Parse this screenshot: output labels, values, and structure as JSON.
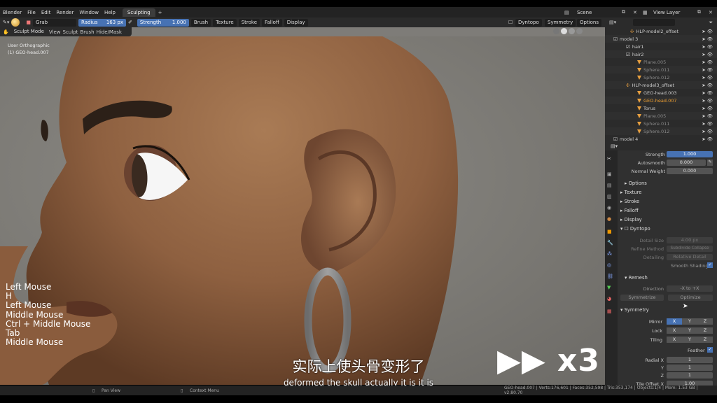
{
  "menu": {
    "items": [
      "Blender",
      "File",
      "Edit",
      "Render",
      "Window",
      "Help"
    ],
    "workspace_tab": "Sculpting",
    "add_tab": "+",
    "scene": "Scene",
    "view_layer": "View Layer"
  },
  "tool": {
    "brush_name": "Grab",
    "radius_label": "Radius",
    "radius_value": "163 px",
    "strength_label": "Strength",
    "strength_value": "1.000",
    "menus": [
      "Brush",
      "Texture",
      "Stroke",
      "Falloff",
      "Display"
    ],
    "dyntopo": "Dyntopo",
    "symmetry": "Symmetry",
    "options": "Options"
  },
  "mode": {
    "mode": "Sculpt Mode",
    "menus": [
      "View",
      "Sculpt",
      "Brush",
      "Hide/Mask"
    ]
  },
  "viewport": {
    "view_name": "User Orthographic",
    "object": "(1) GEO-head.007"
  },
  "keys": [
    "Left Mouse",
    "H",
    "Left Mouse",
    "Middle Mouse",
    "Ctrl + Middle Mouse",
    "Tab",
    "Middle Mouse"
  ],
  "overlay": {
    "speed": "x3",
    "subtitle_cn": "实际上使头骨变形了",
    "subtitle_en": "deformed the skull actually it is it is"
  },
  "outliner": [
    {
      "label": "HLP-model2_offset",
      "indent": 36,
      "type": "empty"
    },
    {
      "label": "model 3",
      "indent": 12,
      "type": "collection"
    },
    {
      "label": "hair1",
      "indent": 30,
      "type": "collection"
    },
    {
      "label": "hair2",
      "indent": 30,
      "type": "collection"
    },
    {
      "label": "Plane.005",
      "indent": 46,
      "type": "mesh",
      "dim": true
    },
    {
      "label": "Sphere.011",
      "indent": 46,
      "type": "mesh",
      "dim": true
    },
    {
      "label": "Sphere.012",
      "indent": 46,
      "type": "mesh",
      "dim": true
    },
    {
      "label": "HLP-model3_offset",
      "indent": 30,
      "type": "empty"
    },
    {
      "label": "GEO-head.003",
      "indent": 46,
      "type": "mesh"
    },
    {
      "label": "GEO-head.007",
      "indent": 46,
      "type": "mesh",
      "active": true
    },
    {
      "label": "Torus",
      "indent": 46,
      "type": "mesh"
    },
    {
      "label": "Plane.005",
      "indent": 46,
      "type": "mesh",
      "dim": true
    },
    {
      "label": "Sphere.011",
      "indent": 46,
      "type": "mesh",
      "dim": true
    },
    {
      "label": "Sphere.012",
      "indent": 46,
      "type": "mesh",
      "dim": true
    },
    {
      "label": "model 4",
      "indent": 12,
      "type": "collection"
    }
  ],
  "props": {
    "strength_label": "Strength",
    "strength_value": "1.000",
    "autosmooth_label": "Autosmooth",
    "autosmooth_value": "0.000",
    "normal_weight_label": "Normal Weight",
    "normal_weight_value": "0.000",
    "options": "Options",
    "texture": "Texture",
    "stroke": "Stroke",
    "falloff": "Falloff",
    "display": "Display",
    "dyntopo": "Dyntopo",
    "detail_size_label": "Detail Size",
    "detail_size_value": "4.00 px",
    "refine_label": "Refine Method",
    "refine_value": "Subdivide Collapse",
    "detailing_label": "Detailing",
    "detailing_value": "Relative Detail",
    "smooth_shading": "Smooth Shading",
    "remesh": "Remesh",
    "direction_label": "Direction",
    "direction_value": "-X to +X",
    "symmetrize": "Symmetrize",
    "optimize": "Optimize",
    "symmetry": "Symmetry",
    "mirror_label": "Mirror",
    "lock_label": "Lock",
    "tiling_label": "Tiling",
    "axis_x": "X",
    "axis_y": "Y",
    "axis_z": "Z",
    "feather_label": "Feather",
    "radial_x_label": "Radial X",
    "radial_y_label": "Y",
    "radial_z_label": "Z",
    "radial_x": "1",
    "radial_y": "1",
    "radial_z": "1",
    "tile_offset_label": "Tile Offset X",
    "tile_offset_value": "1.00"
  },
  "status": {
    "pan_view": "Pan View",
    "context_menu": "Context Menu",
    "stats": "GEO-head.007 | Verts:176,601 | Faces:352,598 | Tris:353,174 | Objects:1/4 | Mem: 1.53 GB | v2.80.70"
  },
  "colors": {
    "accent": "#4772b3",
    "skin": "#9a6a45",
    "active_text": "#f0a030"
  }
}
